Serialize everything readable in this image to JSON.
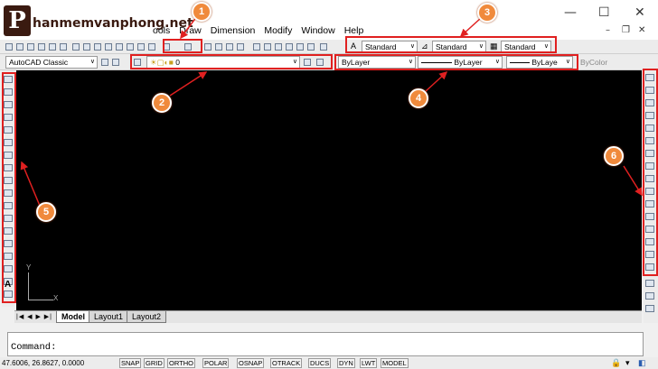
{
  "logo": {
    "mark": "P",
    "text": "hanmemvanphong.net"
  },
  "menu": [
    "ools",
    "Draw",
    "Dimension",
    "Modify",
    "Window",
    "Help"
  ],
  "window_controls": {
    "minimize": "—",
    "maximize": "☐",
    "close": "✕",
    "doc_minimize": "–",
    "doc_restore": "❐",
    "doc_close": "✕"
  },
  "toolbar_styles": {
    "text_style": "Standard",
    "dim_style": "Standard",
    "table_style": "Standard"
  },
  "workspace": {
    "value": "AutoCAD Classic"
  },
  "layer": {
    "value": "0"
  },
  "properties": {
    "color": "ByLayer",
    "linetype": "ByLayer",
    "lineweight": "ByLaye",
    "plotstyle": "ByColor"
  },
  "ucs": {
    "y": "Y",
    "x": "X"
  },
  "tabs": {
    "nav": "|◀ ◀ ▶ ▶|",
    "items": [
      "Model",
      "Layout1",
      "Layout2"
    ]
  },
  "command": {
    "prompt": "Command:"
  },
  "status": {
    "coords": "47.6006, 26.8627, 0.0000",
    "buttons": [
      "SNAP",
      "GRID",
      "ORTHO",
      "POLAR",
      "OSNAP",
      "OTRACK",
      "DUCS",
      "DYN",
      "LWT",
      "MODEL"
    ]
  },
  "callouts": [
    "1",
    "2",
    "3",
    "4",
    "5",
    "6"
  ],
  "colors": {
    "canvas": "#000000",
    "highlight": "#e02020",
    "callout": "#f08a3c"
  }
}
